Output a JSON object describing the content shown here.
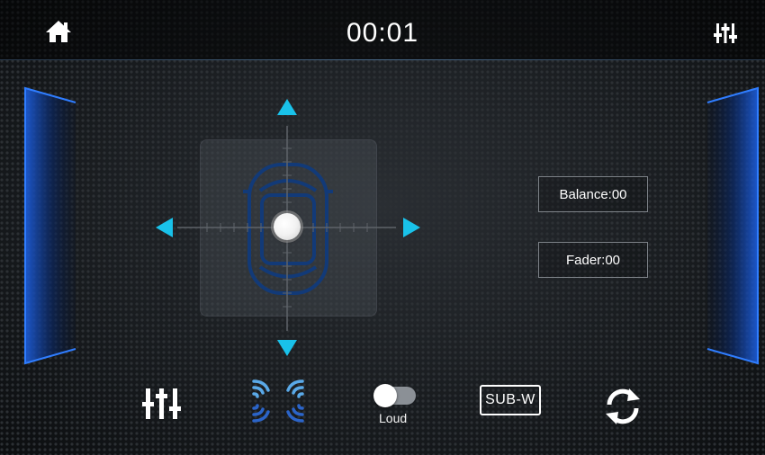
{
  "header": {
    "time": "00:01",
    "home_icon": "home-icon",
    "eq_icon": "equalizer-icon"
  },
  "sound_field": {
    "balance_label": "Balance:00",
    "fader_label": "Fader:00",
    "arrow_color": "#19c2ea",
    "car_color": "#123a78",
    "panel_glow_color": "#1e5cd9"
  },
  "toolbar": {
    "eq_icon": "equalizer-icon",
    "speaker_icon": "speaker-layout-icon",
    "loud_label": "Loud",
    "loud_on": false,
    "subw_label": "SUB-W",
    "reset_icon": "reset-icon"
  }
}
